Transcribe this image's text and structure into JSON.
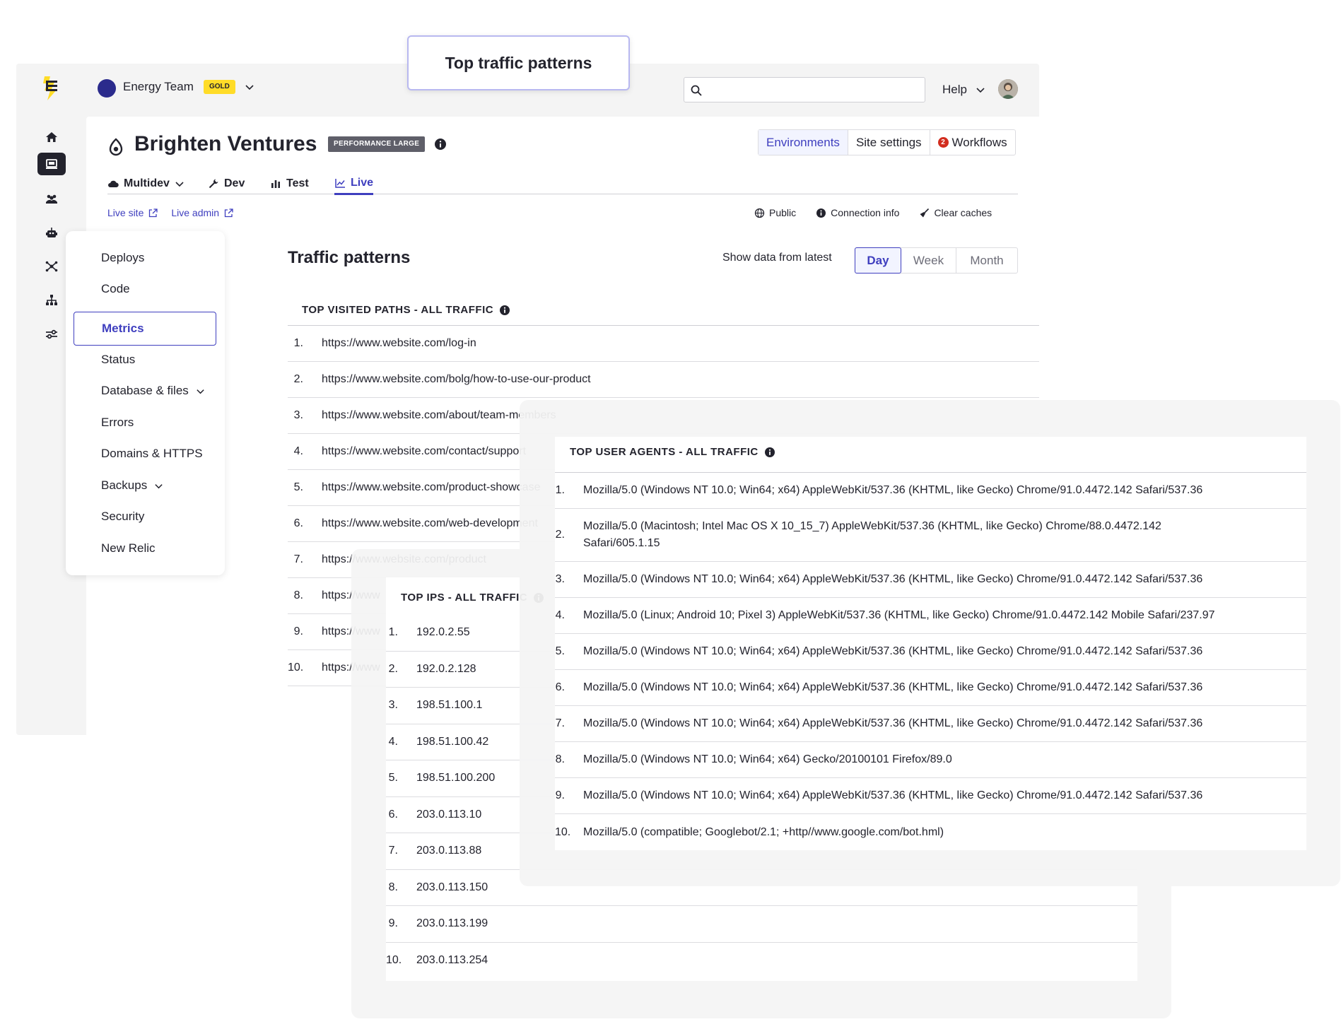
{
  "callout": {
    "label": "Top traffic patterns"
  },
  "topbar": {
    "team_name": "Energy Team",
    "team_tier": "GOLD",
    "search_placeholder": "",
    "help_label": "Help"
  },
  "site": {
    "title": "Brighten Ventures",
    "plan": "PERFORMANCE LARGE",
    "tabs": [
      {
        "label": "Environments",
        "active": true
      },
      {
        "label": "Site settings",
        "active": false
      },
      {
        "label": "Workflows",
        "badge": "2",
        "active": false
      }
    ]
  },
  "env_tabs": [
    {
      "label": "Multidev",
      "icon": "cloud-icon"
    },
    {
      "label": "Dev",
      "icon": "wrench-icon"
    },
    {
      "label": "Test",
      "icon": "bar-chart-icon"
    },
    {
      "label": "Live",
      "icon": "line-chart-icon",
      "active": true
    }
  ],
  "links": [
    {
      "label": "Live site"
    },
    {
      "label": "Live admin"
    }
  ],
  "actions": [
    {
      "label": "Public",
      "icon": "globe-icon"
    },
    {
      "label": "Connection info",
      "icon": "info-icon"
    },
    {
      "label": "Clear caches",
      "icon": "broom-icon"
    }
  ],
  "subnav": {
    "items": [
      {
        "label": "Deploys"
      },
      {
        "label": "Code"
      },
      {
        "label": "Metrics",
        "active": true
      },
      {
        "label": "Status"
      },
      {
        "label": "Database & files",
        "chevron": true
      },
      {
        "label": "Errors"
      },
      {
        "label": "Domains & HTTPS"
      },
      {
        "label": "Backups",
        "chevron": true
      },
      {
        "label": "Security"
      },
      {
        "label": "New Relic"
      }
    ]
  },
  "traffic": {
    "title": "Traffic patterns",
    "range_label": "Show data from latest",
    "ranges": [
      "Day",
      "Week",
      "Month"
    ],
    "active_range": "Day"
  },
  "paths": {
    "title": "TOP VISITED PATHS - ALL TRAFFIC",
    "rows": [
      {
        "num": "1.",
        "value": "https://www.website.com/log-in"
      },
      {
        "num": "2.",
        "value": "https://www.website.com/bolg/how-to-use-our-product"
      },
      {
        "num": "3.",
        "value": "https://www.website.com/about/team-members"
      },
      {
        "num": "4.",
        "value": "https://www.website.com/contact/support"
      },
      {
        "num": "5.",
        "value": "https://www.website.com/product-showcase"
      },
      {
        "num": "6.",
        "value": "https://www.website.com/web-development"
      },
      {
        "num": "7.",
        "value": "https://www.website.com/product"
      },
      {
        "num": "8.",
        "value": "https://www"
      },
      {
        "num": "9.",
        "value": "https://www"
      },
      {
        "num": "10.",
        "value": "https://www"
      }
    ]
  },
  "ips": {
    "title": "TOP IPS - ALL TRAFFIC",
    "rows": [
      {
        "num": "1.",
        "value": "192.0.2.55"
      },
      {
        "num": "2.",
        "value": "192.0.2.128"
      },
      {
        "num": "3.",
        "value": "198.51.100.1"
      },
      {
        "num": "4.",
        "value": "198.51.100.42"
      },
      {
        "num": "5.",
        "value": "198.51.100.200"
      },
      {
        "num": "6.",
        "value": "203.0.113.10"
      },
      {
        "num": "7.",
        "value": "203.0.113.88"
      },
      {
        "num": "8.",
        "value": "203.0.113.150"
      },
      {
        "num": "9.",
        "value": "203.0.113.199"
      },
      {
        "num": "10.",
        "value": "203.0.113.254"
      }
    ]
  },
  "agents": {
    "title": "TOP USER AGENTS - ALL TRAFFIC",
    "rows": [
      {
        "num": "1.",
        "value": "Mozilla/5.0 (Windows NT 10.0; Win64; x64) AppleWebKit/537.36 (KHTML, like Gecko) Chrome/91.0.4472.142 Safari/537.36"
      },
      {
        "num": "2.",
        "value": "Mozilla/5.0 (Macintosh; Intel Mac OS X 10_15_7) AppleWebKit/537.36 (KHTML, like Gecko) Chrome/88.0.4472.142 Safari/605.1.15"
      },
      {
        "num": "3.",
        "value": "Mozilla/5.0 (Windows NT 10.0; Win64; x64) AppleWebKit/537.36 (KHTML, like Gecko) Chrome/91.0.4472.142 Safari/537.36"
      },
      {
        "num": "4.",
        "value": "Mozilla/5.0 (Linux; Android 10; Pixel 3) AppleWebKit/537.36 (KHTML, like Gecko) Chrome/91.0.4472.142  Mobile Safari/237.97"
      },
      {
        "num": "5.",
        "value": "Mozilla/5.0 (Windows NT 10.0; Win64; x64) AppleWebKit/537.36 (KHTML, like Gecko) Chrome/91.0.4472.142 Safari/537.36"
      },
      {
        "num": "6.",
        "value": "Mozilla/5.0 (Windows NT 10.0; Win64; x64) AppleWebKit/537.36 (KHTML, like Gecko) Chrome/91.0.4472.142 Safari/537.36"
      },
      {
        "num": "7.",
        "value": "Mozilla/5.0 (Windows NT 10.0; Win64; x64) AppleWebKit/537.36 (KHTML, like Gecko) Chrome/91.0.4472.142 Safari/537.36"
      },
      {
        "num": "8.",
        "value": "Mozilla/5.0 (Windows NT 10.0; Win64; x64) Gecko/20100101 Firefox/89.0"
      },
      {
        "num": "9.",
        "value": "Mozilla/5.0 (Windows NT 10.0; Win64; x64) AppleWebKit/537.36 (KHTML, like Gecko) Chrome/91.0.4472.142 Safari/537.36"
      },
      {
        "num": "10.",
        "value": "Mozilla/5.0 (compatible; Googlebot/2.1; +http//www.google.com/bot.hml)"
      }
    ]
  },
  "colors": {
    "accent": "#3f3fbf",
    "gold": "#ffdc28",
    "text": "#23232d",
    "alert": "#d22d1e"
  }
}
